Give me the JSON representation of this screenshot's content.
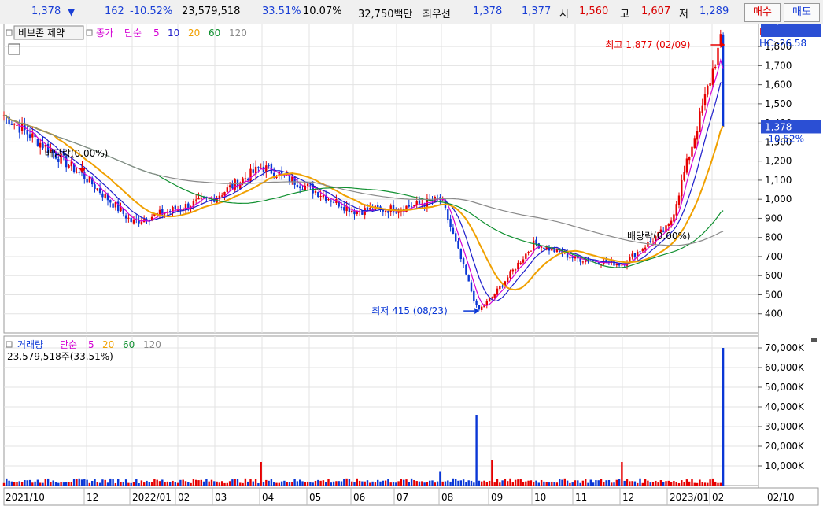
{
  "topbar": {
    "price": "1,378",
    "price_arrow": "▼",
    "change": "162",
    "change_pct": "-10.52%",
    "volume": "23,579,518",
    "volume_ratio": "33.51%",
    "turnover": "10.07%",
    "trade_value": "32,750백만",
    "quote_label": "최우선",
    "best_ask": "1,378",
    "best_bid": "1,377",
    "open_label": "시",
    "open": "1,560",
    "high_label": "고",
    "high": "1,607",
    "low_label": "저",
    "low": "1,289",
    "buy_label": "매수",
    "sell_label": "매도"
  },
  "colors": {
    "up": "#e60000",
    "down": "#0a37d6",
    "ma5": "#d400d4",
    "ma10": "#1d1dcc",
    "ma20": "#f0a000",
    "ma60": "#109030",
    "ma120": "#8a8a8a",
    "grid": "#e3e3e3",
    "axis_bg": "#ffffff",
    "last_box": "#2b4fd4"
  },
  "chart_data": [
    {
      "type": "candlestick",
      "legend": {
        "left_box": "비보존 제약",
        "price_label": "종가",
        "ma_label": "단순",
        "ma_periods": [
          "5",
          "10",
          "20",
          "60",
          "120"
        ]
      },
      "ylim": [
        300,
        1920
      ],
      "y_ticks": [
        "1,800",
        "1,700",
        "1,600",
        "1,500",
        "1,400",
        "1,300",
        "1,200",
        "1,100",
        "1,000",
        "900",
        "800",
        "700",
        "600",
        "500",
        "400"
      ],
      "lc_label": "LC:232.05",
      "hc_label": "HC:-26.58",
      "last_price": "1,378",
      "last_change": "-10.52%",
      "annotations": {
        "high": "최고 1,877 (02/09)",
        "low": "최저 415 (08/23)",
        "dividend1": "배당락(0.00%)",
        "dividend2": "배당락(0.00%)"
      },
      "key_points": [
        {
          "date": "2021/10",
          "close": 1440
        },
        {
          "date": "2021/12",
          "close": 1110
        },
        {
          "date": "2022/01",
          "close": 880
        },
        {
          "date": "2022/03",
          "close": 1010
        },
        {
          "date": "2022/04",
          "close": 1170
        },
        {
          "date": "2022/05",
          "close": 1060
        },
        {
          "date": "2022/06",
          "close": 940
        },
        {
          "date": "2022/07",
          "close": 950
        },
        {
          "date": "2022/08",
          "close": 1000
        },
        {
          "date": "2022/08/23",
          "close": 415
        },
        {
          "date": "2022/09",
          "close": 480
        },
        {
          "date": "2022/10",
          "close": 770
        },
        {
          "date": "2022/11",
          "close": 690
        },
        {
          "date": "2022/12",
          "close": 660
        },
        {
          "date": "2023/01",
          "close": 860
        },
        {
          "date": "2023/02/09",
          "close": 1877
        },
        {
          "date": "2023/02/10",
          "close": 1378
        }
      ]
    },
    {
      "type": "bar",
      "legend": {
        "label": "거래량",
        "ma_label": "단순",
        "ma_periods": [
          "5",
          "20",
          "60",
          "120"
        ]
      },
      "info": "23,579,518주(33.51%)",
      "ylim": [
        0,
        76000
      ],
      "y_ticks": [
        "70,000K",
        "60,000K",
        "50,000K",
        "40,000K",
        "30,000K",
        "20,000K",
        "10,000K"
      ],
      "last_volume": "23,580K",
      "last_ratio": "33.51%",
      "spikes": [
        {
          "date": "2022/04",
          "value_k": 12000
        },
        {
          "date": "2022/08",
          "value_k": 7000
        },
        {
          "date": "2022/08/23",
          "value_k": 36000
        },
        {
          "date": "2022/09",
          "value_k": 13000
        },
        {
          "date": "2022/12",
          "value_k": 12000
        },
        {
          "date": "2023/02/09",
          "value_k": 70000
        },
        {
          "date": "2023/02/10",
          "value_k": 23580
        }
      ]
    }
  ],
  "x_axis": [
    "2021/10",
    "12",
    "2022/01",
    "02",
    "03",
    "04",
    "05",
    "06",
    "07",
    "08",
    "09",
    "10",
    "11",
    "12",
    "2023/01",
    "02",
    "02/10"
  ]
}
